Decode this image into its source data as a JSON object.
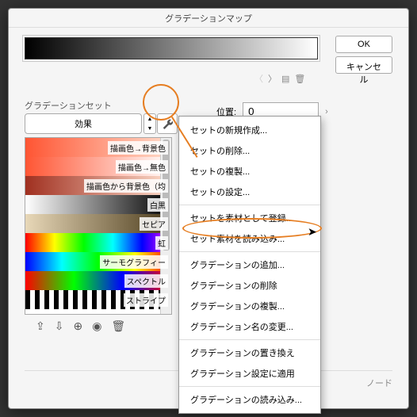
{
  "dialog": {
    "title": "グラデーションマップ",
    "ok": "OK",
    "cancel": "キャンセル",
    "position_label": "位置:",
    "position_value": "0",
    "section_label": "グラデーションセット",
    "set_name": "効果",
    "node_label": "ノード"
  },
  "gradients": [
    {
      "label": "描画色→背景色",
      "css": "linear-gradient(to right,#ff5533,#ffddcc)"
    },
    {
      "label": "描画色→無色",
      "css": "linear-gradient(to right,#ff5533,#ffffff)"
    },
    {
      "label": "描画色から背景色（均",
      "css": "linear-gradient(to right,#a03020,#ffddcc)"
    },
    {
      "label": "白黒",
      "css": "linear-gradient(to right,#fff,#000)"
    },
    {
      "label": "セピア",
      "css": "linear-gradient(to right,#e8d8b8,#4a3a1a)"
    },
    {
      "label": "虹",
      "css": "linear-gradient(to right,#f00,#ff0,#0f0,#0ff,#00f,#f0f)"
    },
    {
      "label": "サーモグラフィー",
      "css": "linear-gradient(to right,#00f,#0ff,#0f0,#ff0,#f00)"
    },
    {
      "label": "スペクトル",
      "css": "linear-gradient(to right,#f00,#0f0,#00f,#f00)"
    },
    {
      "label": "ストライプ",
      "css": "repeating-linear-gradient(to right,#000 0 6px,#fff 6px 12px)"
    }
  ],
  "menu": {
    "items": [
      {
        "text": "セットの新規作成...",
        "sep": false
      },
      {
        "text": "セットの削除...",
        "sep": false
      },
      {
        "text": "セットの複製...",
        "sep": false
      },
      {
        "text": "セットの設定...",
        "sep": true
      },
      {
        "text": "セットを素材として登録...",
        "sep": false
      },
      {
        "text": "セット素材を読み込み...",
        "sep": true,
        "highlight": true
      },
      {
        "text": "グラデーションの追加...",
        "sep": false
      },
      {
        "text": "グラデーションの削除",
        "sep": false
      },
      {
        "text": "グラデーションの複製...",
        "sep": false
      },
      {
        "text": "グラデーション名の変更...",
        "sep": true
      },
      {
        "text": "グラデーションの置き換え",
        "sep": false
      },
      {
        "text": "グラデーション設定に適用",
        "sep": true
      },
      {
        "text": "グラデーションの読み込み...",
        "sep": false
      }
    ]
  }
}
